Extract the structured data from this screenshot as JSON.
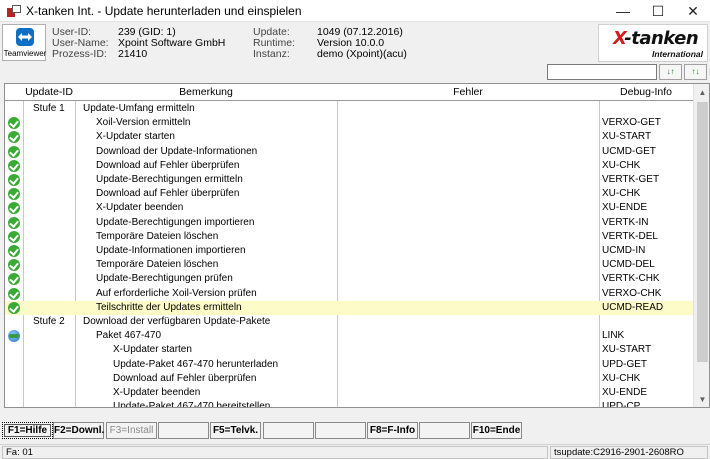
{
  "window": {
    "title": "X-tanken Int. - Update herunterladen und einspielen",
    "minimize_glyph": "—",
    "maximize_glyph": "☐",
    "close_glyph": "✕"
  },
  "teamviewer": {
    "label": "Teamviewer",
    "icon": "teamviewer-icon"
  },
  "info": {
    "user_id_label": "User-ID:",
    "user_id": "239 (GID: 1)",
    "user_name_label": "User-Name:",
    "user_name": "Xpoint Software GmbH",
    "process_id_label": "Prozess-ID:",
    "process_id": "21410",
    "update_label": "Update:",
    "update": "1049 (07.12.2016)",
    "runtime_label": "Runtime:",
    "runtime": "Version 10.0.0",
    "instance_label": "Instanz:",
    "instance": "demo (Xpoint)(acu)"
  },
  "logo": {
    "text_x": "X",
    "text_main": "-tanken",
    "sub": "International"
  },
  "search": {
    "value": "",
    "placeholder": ""
  },
  "sort_buttons": [
    {
      "label": "↓↑",
      "icon": "sort-ascending-icon"
    },
    {
      "label": "↑↓",
      "icon": "sort-descending-icon"
    }
  ],
  "grid": {
    "columns": [
      "Update-ID",
      "Bemerkung",
      "Fehler",
      "Debug-Info"
    ],
    "rows": [
      {
        "status": "",
        "id": "Stufe 1",
        "text": "Update-Umfang ermitteln",
        "level": 0,
        "error": "",
        "debug": ""
      },
      {
        "status": "ok",
        "id": "",
        "text": "Xoil-Version ermitteln",
        "level": 1,
        "error": "",
        "debug": "VERXO-GET"
      },
      {
        "status": "ok",
        "id": "",
        "text": "X-Updater starten",
        "level": 1,
        "error": "",
        "debug": "XU-START"
      },
      {
        "status": "ok",
        "id": "",
        "text": "Download der Update-Informationen",
        "level": 1,
        "error": "",
        "debug": "UCMD-GET"
      },
      {
        "status": "ok",
        "id": "",
        "text": "Download auf Fehler überprüfen",
        "level": 1,
        "error": "",
        "debug": "XU-CHK"
      },
      {
        "status": "ok",
        "id": "",
        "text": "Update-Berechtigungen ermitteln",
        "level": 1,
        "error": "",
        "debug": "VERTK-GET"
      },
      {
        "status": "ok",
        "id": "",
        "text": "Download auf Fehler überprüfen",
        "level": 1,
        "error": "",
        "debug": "XU-CHK"
      },
      {
        "status": "ok",
        "id": "",
        "text": "X-Updater beenden",
        "level": 1,
        "error": "",
        "debug": "XU-ENDE"
      },
      {
        "status": "ok",
        "id": "",
        "text": "Update-Berechtigungen importieren",
        "level": 1,
        "error": "",
        "debug": "VERTK-IN"
      },
      {
        "status": "ok",
        "id": "",
        "text": "Temporäre Dateien löschen",
        "level": 1,
        "error": "",
        "debug": "VERTK-DEL"
      },
      {
        "status": "ok",
        "id": "",
        "text": "Update-Informationen importieren",
        "level": 1,
        "error": "",
        "debug": "UCMD-IN"
      },
      {
        "status": "ok",
        "id": "",
        "text": "Temporäre Dateien löschen",
        "level": 1,
        "error": "",
        "debug": "UCMD-DEL"
      },
      {
        "status": "ok",
        "id": "",
        "text": "Update-Berechtigungen prüfen",
        "level": 1,
        "error": "",
        "debug": "VERTK-CHK"
      },
      {
        "status": "ok",
        "id": "",
        "text": "Auf erforderliche Xoil-Version prüfen",
        "level": 1,
        "error": "",
        "debug": "VERXO-CHK"
      },
      {
        "status": "ok",
        "id": "",
        "text": "Teilschritte der Updates ermitteln",
        "level": 1,
        "error": "",
        "debug": "UCMD-READ",
        "selected": true
      },
      {
        "status": "",
        "id": "Stufe 2",
        "text": "Download der verfügbaren Update-Pakete",
        "level": 0,
        "error": "",
        "debug": ""
      },
      {
        "status": "link",
        "id": "",
        "text": "Paket 467-470",
        "level": 1,
        "error": "",
        "debug": "LINK"
      },
      {
        "status": "",
        "id": "",
        "text": "X-Updater starten",
        "level": 2,
        "error": "",
        "debug": "XU-START"
      },
      {
        "status": "",
        "id": "",
        "text": "Update-Paket 467-470 herunterladen",
        "level": 2,
        "error": "",
        "debug": "UPD-GET"
      },
      {
        "status": "",
        "id": "",
        "text": "Download auf Fehler überprüfen",
        "level": 2,
        "error": "",
        "debug": "XU-CHK"
      },
      {
        "status": "",
        "id": "",
        "text": "X-Updater beenden",
        "level": 2,
        "error": "",
        "debug": "XU-ENDE"
      },
      {
        "status": "",
        "id": "",
        "text": "Update-Paket 467-470 bereitstellen",
        "level": 2,
        "error": "",
        "debug": "UPD-CP"
      }
    ]
  },
  "function_keys": [
    {
      "label": "F1=Hilfe",
      "enabled": true,
      "focus": true
    },
    {
      "label": "F2=Downl.",
      "enabled": true
    },
    {
      "label": "F3=Install",
      "enabled": false
    },
    {
      "label": "",
      "enabled": true
    },
    {
      "label": "F5=Telvk.",
      "enabled": true
    },
    {
      "label": "",
      "enabled": true
    },
    {
      "label": "",
      "enabled": true
    },
    {
      "label": "F8=F-Info",
      "enabled": true
    },
    {
      "label": "",
      "enabled": true
    },
    {
      "label": "F10=Ende",
      "enabled": true
    }
  ],
  "statusbar": {
    "left": "Fa: 01",
    "right": "tsupdate:C2916-2901-2608RO"
  }
}
